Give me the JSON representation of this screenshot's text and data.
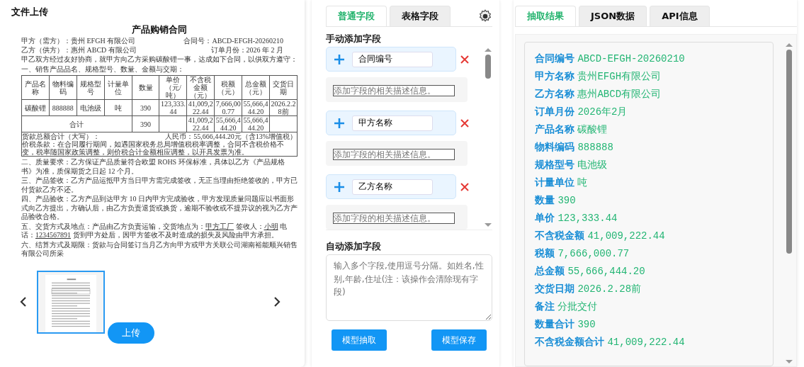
{
  "upload_panel": {
    "title": "文件上传",
    "document": {
      "title": "产品购销合同",
      "meta": [
        {
          "left": "甲方（需方）：贵州 EFGH 有限公司",
          "right": "合同号：ABCD-EFGH-20260210"
        },
        {
          "left": "乙方（供方）：惠州 ABCD 有限公司",
          "right": "订单月份：2026 年 2 月"
        }
      ],
      "intro": "甲乙双方经过友好协商，就甲方向乙方采购碳酸锂一事，达成如下合同，以供双方遵守：",
      "section_heading": "一、销售产品品名、规格型号、数量、金额与交期：",
      "table": {
        "columns": [
          "产品名称",
          "物料编码",
          "规格型号",
          "计量单位",
          "数量",
          "单价（元/吨）",
          "不含税金额（元）",
          "税额（元）",
          "总金额（元）",
          "交货日期"
        ],
        "rows": [
          [
            "碳酸锂",
            "888888",
            "电池级",
            "吨",
            "390",
            "123,333.44",
            "41,009,222.44",
            "7,666,000.77",
            "55,666,444.20",
            "2026.2.28前"
          ]
        ],
        "total": {
          "label": "合计",
          "cells": [
            "390",
            null,
            "41,009,222.44",
            "55,666,444.20",
            "55,666,444.20",
            null
          ]
        },
        "sum_label": "货款总额合计（大写）：",
        "sum_value": "人民币：55,666,444.20元（含13%增值税）",
        "tax_clause": "价税条款：在合同履行期间，如遇国家税务总局增值税税率调整，合同不含税价格不变，税率随国家政策调整，则价税合计金额相应调整，以开具发票为准。"
      },
      "sections": [
        {
          "parts": [
            {
              "text": "二、质量要求：乙方保证产品质量符合欧盟 ROHS 环保标准，具体以乙方《产品规格书》为准，质保期货之日起 12 个月。",
              "underlined": false
            }
          ]
        },
        {
          "parts": [
            {
              "text": "三、产品签收：乙方产品运抵甲方当日甲方需完成签收，无正当理由拒绝签收的，甲方已付货款乙方不还。",
              "underlined": false
            }
          ]
        },
        {
          "parts": [
            {
              "text": "四、产品验收：乙方产品到达甲方 10 日内甲方完成验收，甲方发现质量问题应以书面形式向乙方提出，方确认后，由乙方负责退货或换货，逾期不验收或不提异议的视为乙方产品验收合格。",
              "underlined": false
            }
          ]
        },
        {
          "parts": [
            {
              "text": "五、交货方式及地点：产品由乙方负责运输，交货地点为：",
              "underlined": false
            },
            {
              "text": "甲方工厂",
              "underlined": true
            },
            {
              "text": " 签收人：",
              "underlined": false
            },
            {
              "text": "小明",
              "underlined": true
            },
            {
              "text": " 电话：",
              "underlined": false
            },
            {
              "text": "1234567891",
              "underlined": true
            },
            {
              "text": " 货到甲方处后，因甲方签收不及时造成的损失及风险由甲方承担。",
              "underlined": false
            }
          ]
        },
        {
          "parts": [
            {
              "text": "六、结算方式及期限：货款与合同签订当月乙方向甲方或甲方关联公司湖南裕能顺兴销售有限公司所采",
              "underlined": false
            }
          ]
        }
      ]
    },
    "thumbnails": [
      {
        "selected": true
      }
    ],
    "upload_button": "上传"
  },
  "fields_panel": {
    "tabs": [
      {
        "label": "普通字段",
        "selected": true
      },
      {
        "label": "表格字段",
        "selected": false
      }
    ],
    "manual_heading": "手动添加字段",
    "fields": [
      {
        "name": "合同编号",
        "description_placeholder": "添加字段的相关描述信息。"
      },
      {
        "name": "甲方名称",
        "description_placeholder": "添加字段的相关描述信息。"
      },
      {
        "name": "乙方名称",
        "description_placeholder": "添加字段的相关描述信息。"
      }
    ],
    "auto_heading": "自动添加字段",
    "auto_placeholder": "输入多个字段,使用逗号分隔。如姓名,性别,年龄,住址(注：该操作会清除现有字段)",
    "buttons": [
      "模型抽取",
      "模型保存"
    ]
  },
  "result_panel": {
    "tabs": [
      {
        "label": "抽取结果",
        "selected": true
      },
      {
        "label": "JSON数据",
        "selected": false
      },
      {
        "label": "API信息",
        "selected": false
      }
    ],
    "results": [
      {
        "key": "合同编号",
        "value": "ABCD-EFGH-20260210"
      },
      {
        "key": "甲方名称",
        "value": "贵州EFGH有限公司"
      },
      {
        "key": "乙方名称",
        "value": "惠州ABCD有限公司"
      },
      {
        "key": "订单月份",
        "value": "2026年2月"
      },
      {
        "key": "产品名称",
        "value": "碳酸锂"
      },
      {
        "key": "物料编码",
        "value": "888888"
      },
      {
        "key": "规格型号",
        "value": "电池级"
      },
      {
        "key": "计量单位",
        "value": "吨"
      },
      {
        "key": "数量",
        "value": "390"
      },
      {
        "key": "单价",
        "value": "123,333.44"
      },
      {
        "key": "不含税金额",
        "value": "41,009,222.44"
      },
      {
        "key": "税额",
        "value": "7,666,000.77"
      },
      {
        "key": "总金额",
        "value": "55,666,444.20"
      },
      {
        "key": "交货日期",
        "value": "2026.2.28前"
      },
      {
        "key": "备注",
        "value": "分批交付"
      },
      {
        "key": "数量合计",
        "value": "390"
      },
      {
        "key": "不含税金额合计",
        "value": "41,009,222.44"
      }
    ]
  }
}
